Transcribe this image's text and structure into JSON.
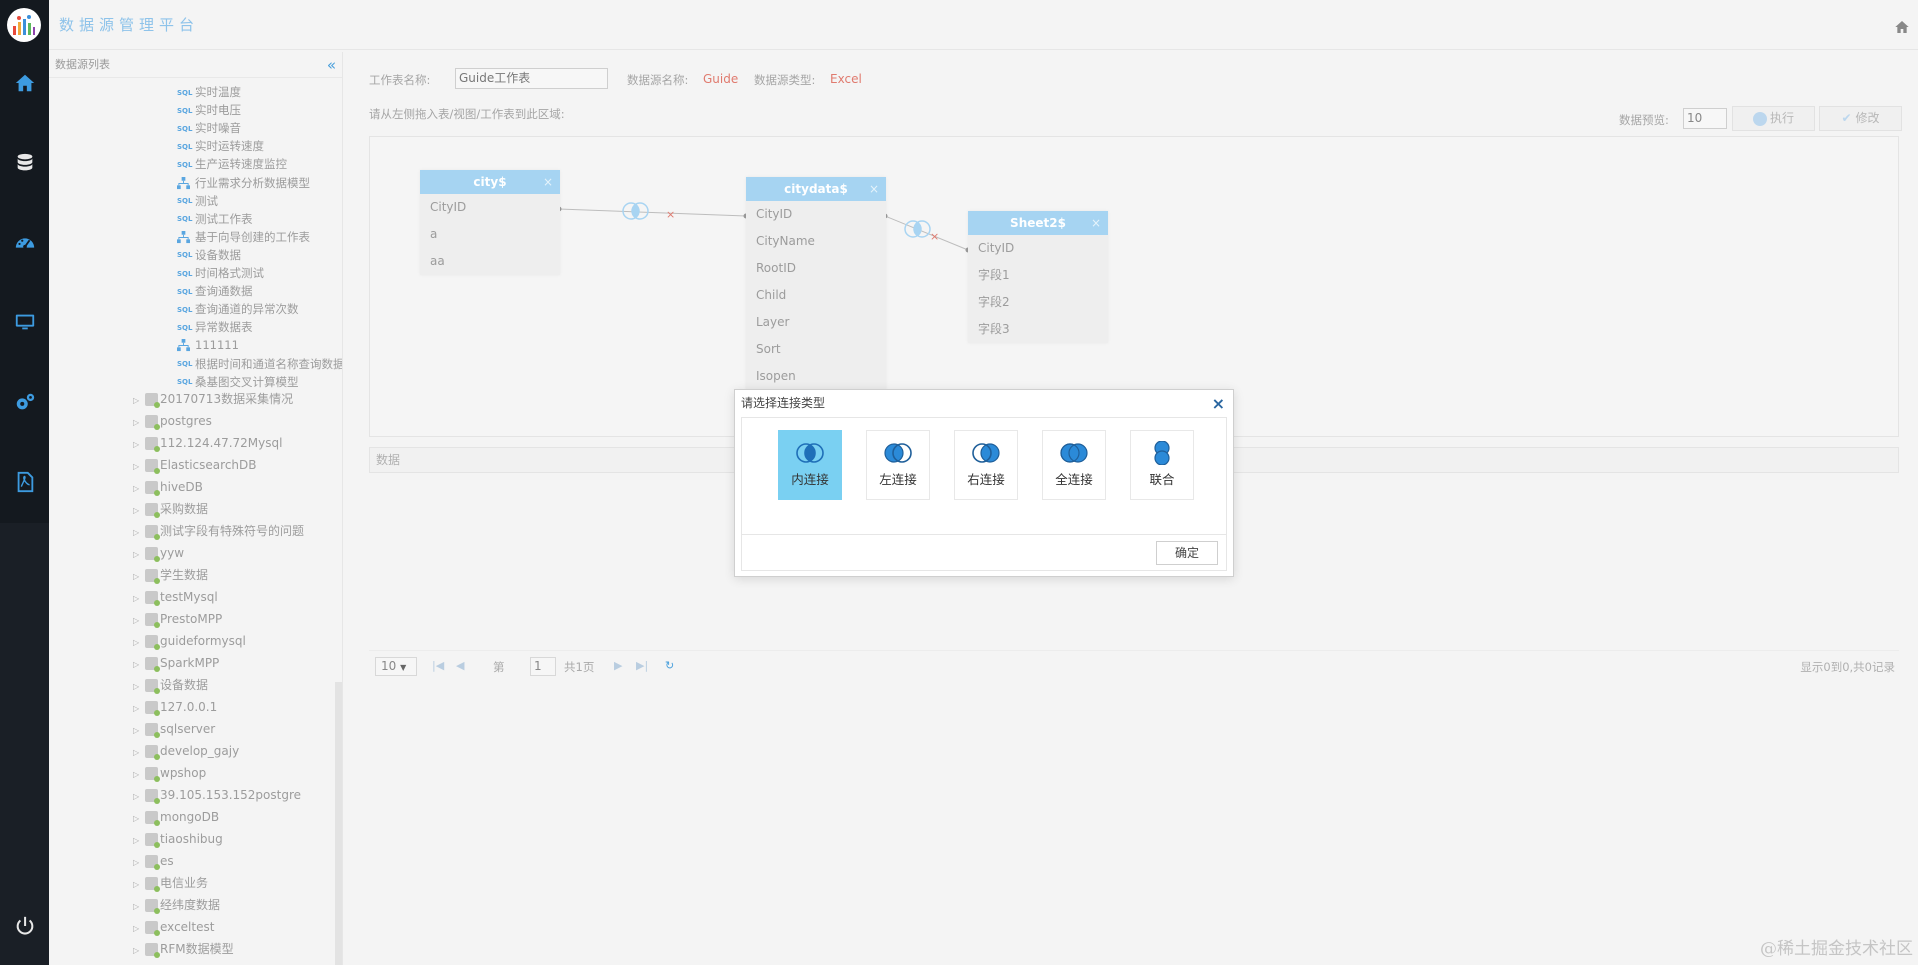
{
  "app": {
    "title": "数据源管理平台"
  },
  "colors": {
    "accent": "#4aa0dc",
    "table_header": "#a6d4f2",
    "rail": "#14191f",
    "source_value": "#e07a6e"
  },
  "rail": {
    "icons": [
      "home-icon",
      "database-icon",
      "dashboard-icon",
      "monitor-icon",
      "settings-icon",
      "pdf-icon",
      "power-icon"
    ]
  },
  "tree": {
    "header": "数据源列表",
    "collapse_icon": "«",
    "leaves": [
      {
        "type": "sql",
        "label": "实时温度"
      },
      {
        "type": "sql",
        "label": "实时电压"
      },
      {
        "type": "sql",
        "label": "实时噪音"
      },
      {
        "type": "sql",
        "label": "实时运转速度"
      },
      {
        "type": "sql",
        "label": "生产运转速度监控"
      },
      {
        "type": "model",
        "label": "行业需求分析数据模型"
      },
      {
        "type": "sql",
        "label": "测试"
      },
      {
        "type": "sql",
        "label": "测试工作表"
      },
      {
        "type": "model",
        "label": "基于向导创建的工作表"
      },
      {
        "type": "sql",
        "label": "设备数据"
      },
      {
        "type": "sql",
        "label": "时间格式测试"
      },
      {
        "type": "sql",
        "label": "查询通数据"
      },
      {
        "type": "sql",
        "label": "查询通道的异常次数"
      },
      {
        "type": "sql",
        "label": "异常数据表"
      },
      {
        "type": "model",
        "label": "111111"
      },
      {
        "type": "sql",
        "label": "根据时间和通道名称查询数据明细"
      },
      {
        "type": "sql",
        "label": "桑基图交叉计算模型"
      }
    ],
    "sql_tag": "SQL",
    "databases": [
      "20170713数据采集情况",
      "postgres",
      "112.124.47.72Mysql",
      "ElasticsearchDB",
      "hiveDB",
      "采购数据",
      "测试字段有特殊符号的问题",
      "yyw",
      "学生数据",
      "testMysql",
      "PrestoMPP",
      "guideformysql",
      "SparkMPP",
      "设备数据",
      "127.0.0.1",
      "sqlserver",
      "develop_gajy",
      "wpshop",
      "39.105.153.152postgre",
      "mongoDB",
      "tiaoshibug",
      "es",
      "电信业务",
      "经纬度数据",
      "exceltest",
      "RFM数据模型"
    ]
  },
  "form": {
    "sheet_name_label": "工作表名称:",
    "sheet_name_value": "Guide工作表",
    "source_name_label": "数据源名称:",
    "source_name_value": "Guide",
    "source_type_label": "数据源类型:",
    "source_type_value": "Excel",
    "drag_hint": "请从左侧拖入表/视图/工作表到此区域:",
    "preview_label": "数据预览:",
    "preview_value": "10",
    "run_label": "执行",
    "edit_label": "修改"
  },
  "canvas": {
    "tables": [
      {
        "name": "city$",
        "fields": [
          "CityID",
          "a",
          "aa"
        ]
      },
      {
        "name": "citydata$",
        "fields": [
          "CityID",
          "CityName",
          "RootID",
          "Child",
          "Layer",
          "Sort",
          "Isopen"
        ]
      },
      {
        "name": "Sheet2$",
        "fields": [
          "CityID",
          "字段1",
          "字段2",
          "字段3"
        ]
      }
    ],
    "close_glyph": "×"
  },
  "data_section": {
    "label": "数据"
  },
  "pager": {
    "page_size": "10",
    "page_prefix": "第",
    "page_value": "1",
    "page_suffix": "共1页",
    "summary": "显示0到0,共0记录"
  },
  "modal": {
    "title": "请选择连接类型",
    "close_glyph": "×",
    "options": [
      {
        "label": "内连接",
        "icon": "inner-join-icon",
        "selected": true
      },
      {
        "label": "左连接",
        "icon": "left-join-icon",
        "selected": false
      },
      {
        "label": "右连接",
        "icon": "right-join-icon",
        "selected": false
      },
      {
        "label": "全连接",
        "icon": "full-join-icon",
        "selected": false
      },
      {
        "label": "联合",
        "icon": "union-icon",
        "selected": false
      }
    ],
    "confirm_label": "确定"
  },
  "watermark": "@稀土掘金技术社区"
}
